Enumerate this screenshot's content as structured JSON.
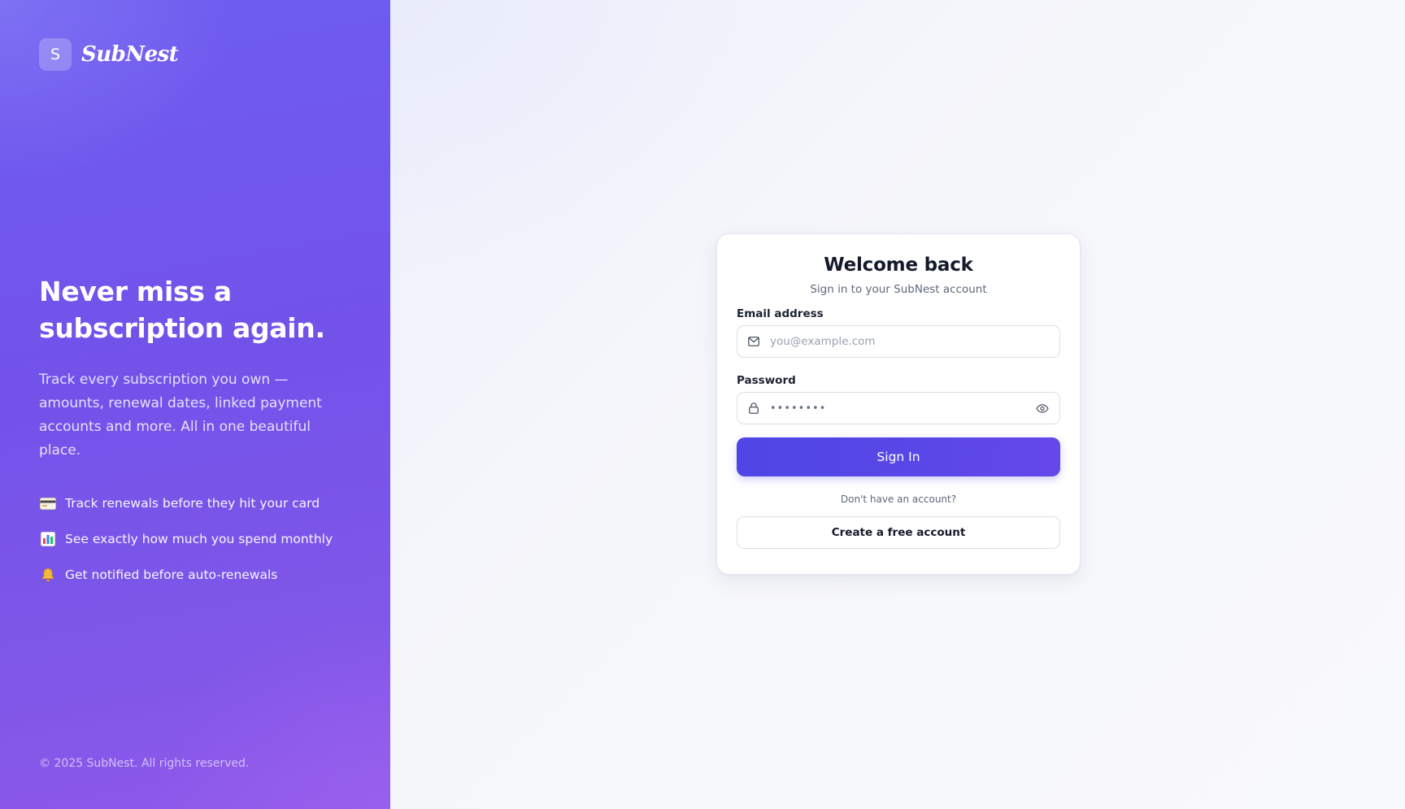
{
  "brand": {
    "badge_letter": "S",
    "name": "SubNest"
  },
  "hero": {
    "title": "Never miss a subscription again.",
    "description": "Track every subscription you own — amounts, renewal dates, linked payment accounts and more. All in one beautiful place.",
    "features": [
      {
        "icon": "credit-card-icon",
        "label": "Track renewals before they hit your card"
      },
      {
        "icon": "bar-chart-icon",
        "label": "See exactly how much you spend monthly"
      },
      {
        "icon": "bell-icon",
        "label": "Get notified before auto-renewals"
      }
    ],
    "copyright": "© 2025 SubNest. All rights reserved."
  },
  "login": {
    "title": "Welcome back",
    "subtitle": "Sign in to your SubNest account",
    "email": {
      "label": "Email address",
      "placeholder": "you@example.com",
      "value": "",
      "icon": "mail-icon"
    },
    "password": {
      "label": "Password",
      "masked_value": "••••••••",
      "icon": "lock-icon",
      "toggle_icon": "eye-icon"
    },
    "submit_label": "Sign In",
    "no_account_text": "Don't have an account?",
    "create_account_label": "Create a free account"
  },
  "colors": {
    "hero_gradient_start": "#6d5df0",
    "hero_gradient_end": "#9059ea",
    "primary_button": "#4f46e5",
    "page_background": "#f5f6fb",
    "card_background": "#ffffff",
    "heading_text": "#141a2b",
    "muted_text": "#5e6779"
  }
}
